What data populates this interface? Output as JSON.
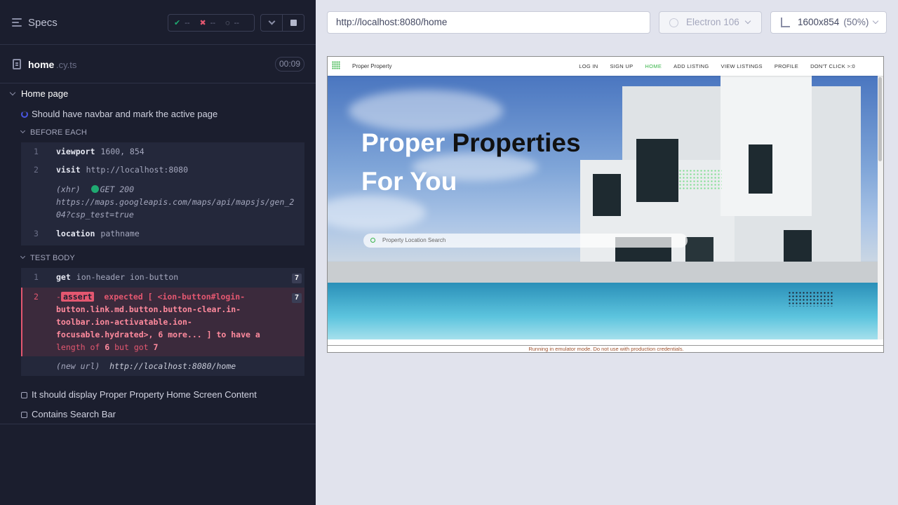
{
  "reporter": {
    "header_title": "Specs",
    "stats": {
      "passed": "--",
      "failed": "--",
      "pending": "--"
    },
    "file": {
      "name": "home",
      "ext": ".cy.ts",
      "duration": "00:09"
    },
    "suite_title": "Home page",
    "running_test": "Should have navbar and mark the active page",
    "before_each": {
      "header": "BEFORE EACH",
      "commands": [
        {
          "num": "1",
          "name": "viewport",
          "arg": "1600, 854"
        },
        {
          "num": "2",
          "name": "visit",
          "arg": "http://localhost:8080"
        },
        {
          "prefix": "(xhr)",
          "status": "GET 200",
          "url_line1": "https://maps.googleapis.com/maps/api/mapsjs/gen_2",
          "url_line2": "04?csp_test=true"
        },
        {
          "num": "3",
          "name": "location",
          "arg": "pathname"
        }
      ]
    },
    "test_body": {
      "header": "TEST BODY",
      "cmd1": {
        "num": "1",
        "name": "get",
        "arg": "ion-header ion-button",
        "count": "7"
      },
      "cmd2": {
        "num": "2",
        "keyword": "assert",
        "line1": "expected [ <ion-button#login-",
        "line2": "button.link.md.button.button-clear.in-",
        "line3": "toolbar.ion-activatable.ion-",
        "line4": "focusable.hydrated>, 6 more... ] to have a",
        "line5_pre": "length of",
        "line5_a": "6",
        "line5_mid": "but got",
        "line5_b": "7",
        "count": "7",
        "expected_word": "expected",
        "to_have": "to have a"
      },
      "new_url": {
        "prefix": "(new url)",
        "url": "http://localhost:8080/home"
      }
    },
    "pending_tests": [
      "It should display Proper Property Home Screen Content",
      "Contains Search Bar"
    ]
  },
  "browser_bar": {
    "url": "http://localhost:8080/home",
    "browser": "Electron 106",
    "viewport": "1600x854",
    "scale": "(50%)"
  },
  "app": {
    "brand": "Proper Property",
    "nav": [
      "LOG IN",
      "SIGN UP",
      "HOME",
      "ADD LISTING",
      "VIEW LISTINGS",
      "PROFILE",
      "DON'T CLICK >:0"
    ],
    "active_nav": "HOME",
    "hero_line1_a": "Proper",
    "hero_line1_b": "Properties",
    "hero_line2": "For You",
    "search_placeholder": "Property Location Search",
    "emulator_notice": "Running in emulator mode. Do not use with production credentials."
  },
  "colors": {
    "pass": "#1fa971",
    "fail": "#e45770",
    "accent": "#39b54a",
    "panel": "#1b1e2e"
  }
}
